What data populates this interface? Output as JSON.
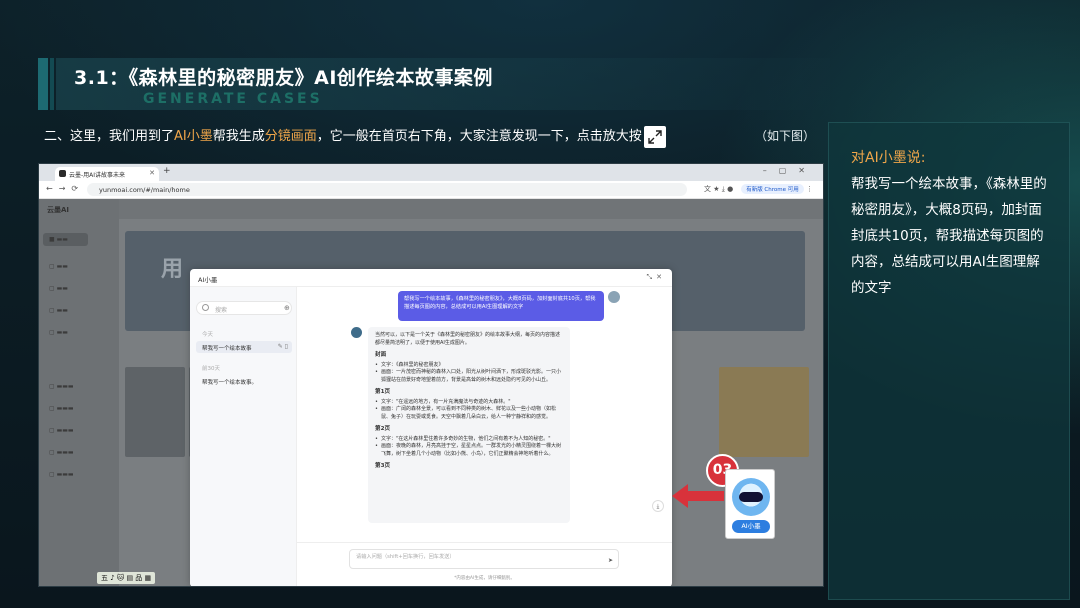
{
  "slide": {
    "title": "3.1：《森林里的秘密朋友》AI创作绘本故事案例",
    "subtitle": "GENERATE CASES",
    "instruction": {
      "p1": "二、这里，我们用到了",
      "h1": "AI小墨",
      "p2": "帮我生成",
      "h2": "分镜画面",
      "p3": "，它一般在首页右下角，大家注意发现一下，点击放大按"
    },
    "see_figure": "（如下图）",
    "badge": "03"
  },
  "side_panel": {
    "title": "对AI小墨说:",
    "body": "帮我写一个绘本故事，《森林里的秘密朋友》，大概8页码，加封面封底共10页，帮我描述每页图的内容，总结成可以用AI生图理解的文字"
  },
  "browser": {
    "tab_title": "云墨-用AI讲故事未来",
    "url": "yunmoai.com/#/main/home",
    "update_label": "有新版 Chrome 可用"
  },
  "app": {
    "logo": "云墨AI",
    "banner_text": "用",
    "taskbar": "五 ♪ 🐱 ▤ 品 ▦"
  },
  "modal": {
    "title": "AI小墨",
    "search_placeholder": "搜索",
    "history": [
      {
        "group": "今天",
        "item": "帮我写一个绘本故事"
      },
      {
        "group": "前30天",
        "item": "帮我写一个绘本故事。"
      }
    ],
    "user_message": "帮我写一个绘本故事，《森林里的秘密朋友》，大概8页码，加封面封底共10页，帮我描述每页图的内容，总结成可以用AI生图理解的文字",
    "bot_intro": "当然可以，以下是一个关于《森林里的秘密朋友》的绘本故事大纲，每页的内容描述都尽量简洁明了，以便于使用AI生成图片。",
    "sections": [
      {
        "heading": "封面",
        "lines": [
          "文字：《森林里的秘密朋友》",
          "画面：一片茂密而神秘的森林入口处，阳光从树叶间洒下，形成斑驳光影。一只小狐狸站在前景好奇地望着前方，背景是高耸的树木和远处隐约可见的小山丘。"
        ]
      },
      {
        "heading": "第1页",
        "lines": [
          "文字：\"在遥远的地方，有一片充满魔法与奇迹的大森林。\"",
          "画面：广阔的森林全景，可以看到不同种类的树木、鲜花以及一些小动物（如松鼠、兔子）在玩耍或觅食。天空中飘着几朵白云，给人一种宁静祥和的感觉。"
        ]
      },
      {
        "heading": "第2页",
        "lines": [
          "文字：\"在这片森林里住着许多奇妙的生物，他们之间有着不为人知的秘密。\"",
          "画面：夜晚的森林，月亮高挂于空，星星点点。一群发光的小精灵围绕着一棵大树飞舞，树下坐着几个小动物（比如小熊、小鸟），它们正聚精会神地听着什么。"
        ]
      },
      {
        "heading": "第3页",
        "lines": []
      }
    ],
    "input_placeholder": "请输入问题（shift+回车换行，回车发送）",
    "disclaimer": "*内容由AI生成，请仔细甄别。"
  },
  "widget": {
    "label": "AI小墨"
  }
}
